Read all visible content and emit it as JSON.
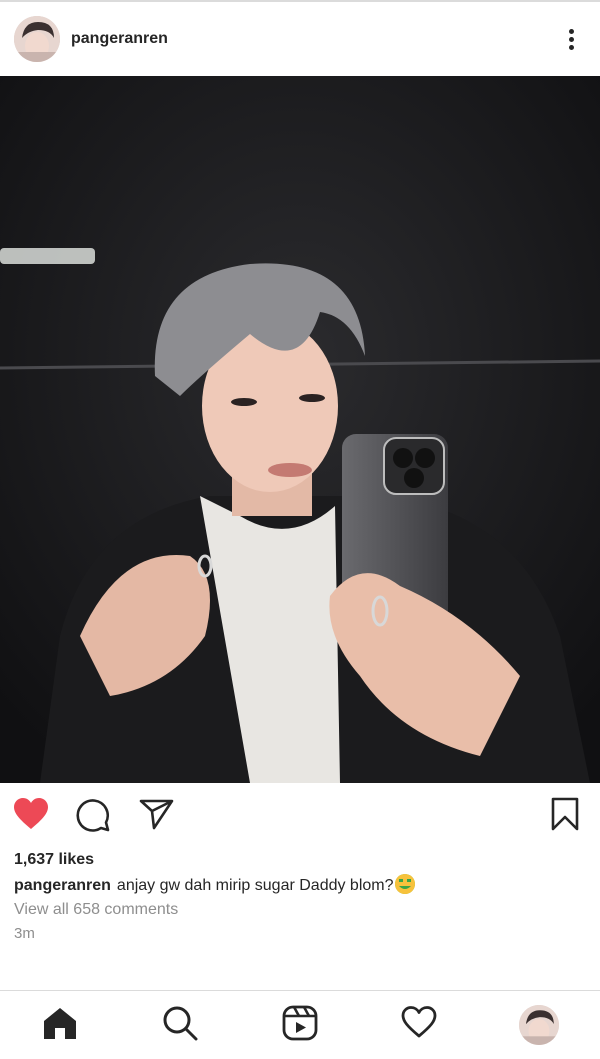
{
  "post": {
    "username": "pangeranren",
    "likes": "1,637 likes",
    "caption_user": "pangeranren",
    "caption_text": "anjay gw dah mirip sugar Daddy blom?",
    "caption_emoji": "money-mouth-face",
    "view_comments": "View all 658 comments",
    "time": "3m"
  },
  "icons": {
    "more": "more-vertical-icon",
    "like": "heart-filled-icon",
    "comment": "comment-icon",
    "share": "send-icon",
    "save": "bookmark-icon",
    "nav": [
      "home-icon",
      "search-icon",
      "reels-icon",
      "heart-icon",
      "profile-avatar"
    ]
  },
  "colors": {
    "like": "#ed4956",
    "text": "#262626",
    "muted": "#8e8e8e",
    "divider": "#dbdbdb"
  }
}
